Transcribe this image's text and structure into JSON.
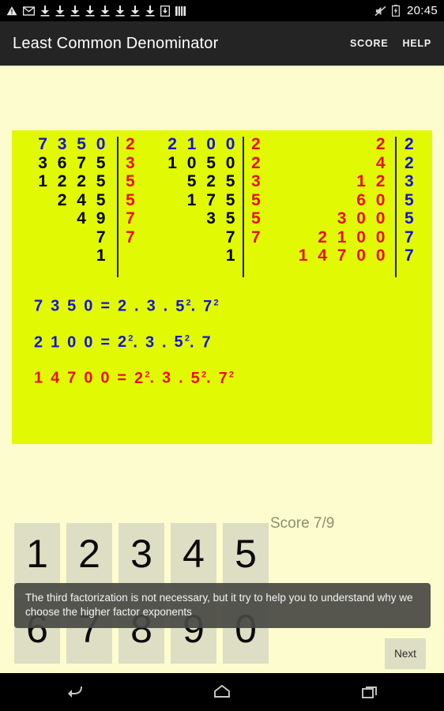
{
  "statusbar": {
    "time": "20:45",
    "left_icons": [
      "warning-triangle-icon",
      "gmail-envelope-icon",
      "download-arrow-icon",
      "download-arrow-icon",
      "download-arrow-icon",
      "download-arrow-icon",
      "download-arrow-icon",
      "download-arrow-icon",
      "download-arrow-icon",
      "download-arrow-icon",
      "download-box-icon",
      "sim-bars-icon"
    ],
    "right_icons": [
      "mute-icon",
      "battery-charging-icon"
    ]
  },
  "actionbar": {
    "title": "Least Common Denominator",
    "score_action": "SCORE",
    "help_action": "HELP"
  },
  "math": {
    "panel_bg": "#e2f904",
    "blue": "#1414d2",
    "red": "#e81010",
    "black": "#000000",
    "col1_quotients": [
      "7350",
      "3675",
      "1225",
      "245",
      "49",
      "7",
      "1"
    ],
    "col1_divisors": [
      "2",
      "3",
      "5",
      "5",
      "7",
      "7"
    ],
    "col2_quotients": [
      "2100",
      "1050",
      "525",
      "175",
      "35",
      "7",
      "1"
    ],
    "col2_divisors": [
      "2",
      "2",
      "3",
      "5",
      "5",
      "7"
    ],
    "col3_products": [
      "2",
      "4",
      "12",
      "60",
      "300",
      "2100",
      "14700"
    ],
    "col3_divisors": [
      "2",
      "2",
      "3",
      "5",
      "5",
      "7",
      "7"
    ],
    "equations": [
      {
        "lhs": "7 3 5 0",
        "rhs_parts": [
          {
            "base": "2",
            "exp": ""
          },
          {
            "base": "3",
            "exp": ""
          },
          {
            "base": "5",
            "exp": "2"
          },
          {
            "base": "7",
            "exp": "2"
          }
        ],
        "color": "#1414d2"
      },
      {
        "lhs": "2 1 0 0",
        "rhs_parts": [
          {
            "base": "2",
            "exp": "2"
          },
          {
            "base": "3",
            "exp": ""
          },
          {
            "base": "5",
            "exp": "2"
          },
          {
            "base": "7",
            "exp": ""
          }
        ],
        "color": "#1414d2"
      },
      {
        "lhs": "1 4 7 0 0",
        "rhs_parts": [
          {
            "base": "2",
            "exp": "2"
          },
          {
            "base": "3",
            "exp": ""
          },
          {
            "base": "5",
            "exp": "2"
          },
          {
            "base": "7",
            "exp": "2"
          }
        ],
        "color": "#e81010"
      }
    ]
  },
  "keypad": {
    "row1": [
      "1",
      "2",
      "3",
      "4",
      "5"
    ],
    "row2": [
      "6",
      "7",
      "8",
      "9",
      "0"
    ],
    "score_text": "Score 7/9",
    "next_label": "Next"
  },
  "toast": {
    "message": "The third factorization is not necessary, but it try to help you to understand why we choose the higher factor exponents"
  },
  "navbar": {
    "back": "back-icon",
    "home": "home-icon",
    "recents": "recents-icon"
  }
}
